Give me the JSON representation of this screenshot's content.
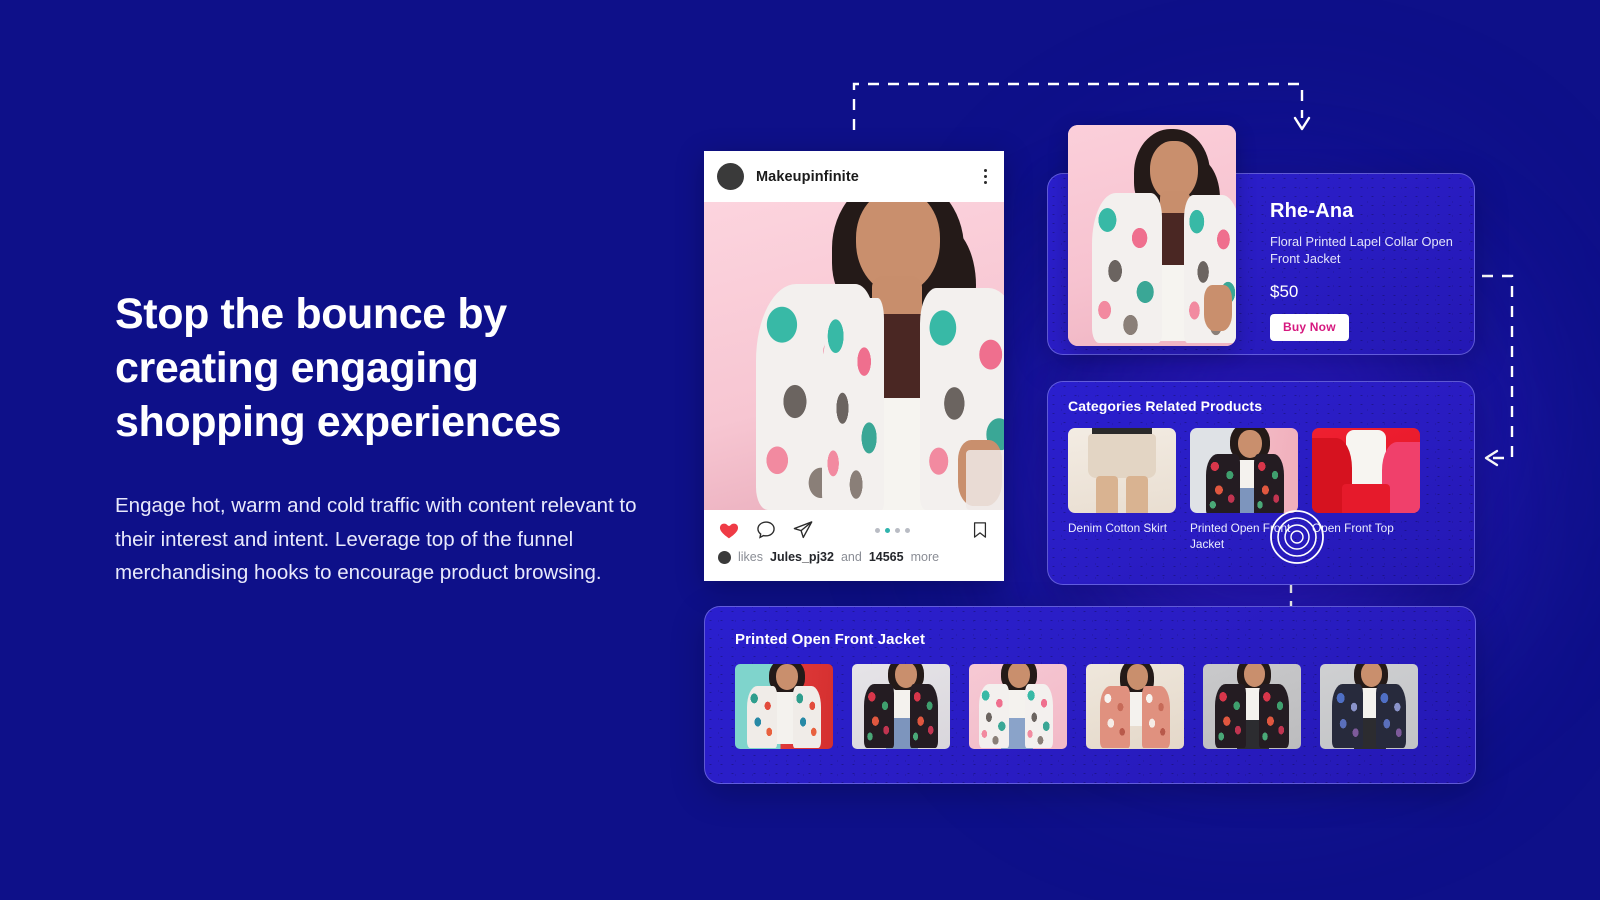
{
  "theme": {
    "bg_navy": "#0e1089",
    "card_blue": "#2a1fce",
    "accent_pink": "#d6187f",
    "text_white": "#ffffff",
    "connector_white": "#ffffff"
  },
  "hero": {
    "headline": "Stop the bounce by creating engaging shopping experiences",
    "body": "Engage hot, warm and cold traffic with content relevant to their interest and intent. Leverage top of the funnel merchandising hooks to encourage product browsing."
  },
  "instagram_post": {
    "username": "Makeupinfinite",
    "menu_icon": "kebab-menu-icon",
    "actions": {
      "like_icon": "heart-icon",
      "comment_icon": "comment-bubble-icon",
      "share_icon": "paper-plane-icon",
      "save_icon": "bookmark-icon"
    },
    "carousel": {
      "count": 4,
      "active_index": 1
    },
    "likes": {
      "prefix": "likes",
      "username": "Jules_pj32",
      "conjunction": "and",
      "count": "14565",
      "suffix": "more"
    }
  },
  "product_card": {
    "brand": "Rhe-Ana",
    "description": "Floral Printed Lapel Collar Open Front Jacket",
    "price": "$50",
    "buy_label": "Buy Now"
  },
  "categories_card": {
    "title": "Categories Related Products",
    "items": [
      {
        "label": "Denim Cotton Skirt",
        "highlighted": false
      },
      {
        "label": "Printed Open Front Jacket",
        "highlighted": true
      },
      {
        "label": "Open Front Top",
        "highlighted": false
      }
    ]
  },
  "gallery_card": {
    "title": "Printed Open Front Jacket",
    "thumb_count": 6
  },
  "connectors": [
    {
      "name": "post-to-product",
      "style": "dashed",
      "arrow": "down"
    },
    {
      "name": "product-to-categories",
      "style": "dashed",
      "arrow": "left"
    },
    {
      "name": "category-to-gallery",
      "style": "dashed",
      "arrow": "down"
    }
  ],
  "click_indicator": {
    "name": "ripple-click-indicator",
    "target": "Printed Open Front Jacket"
  }
}
